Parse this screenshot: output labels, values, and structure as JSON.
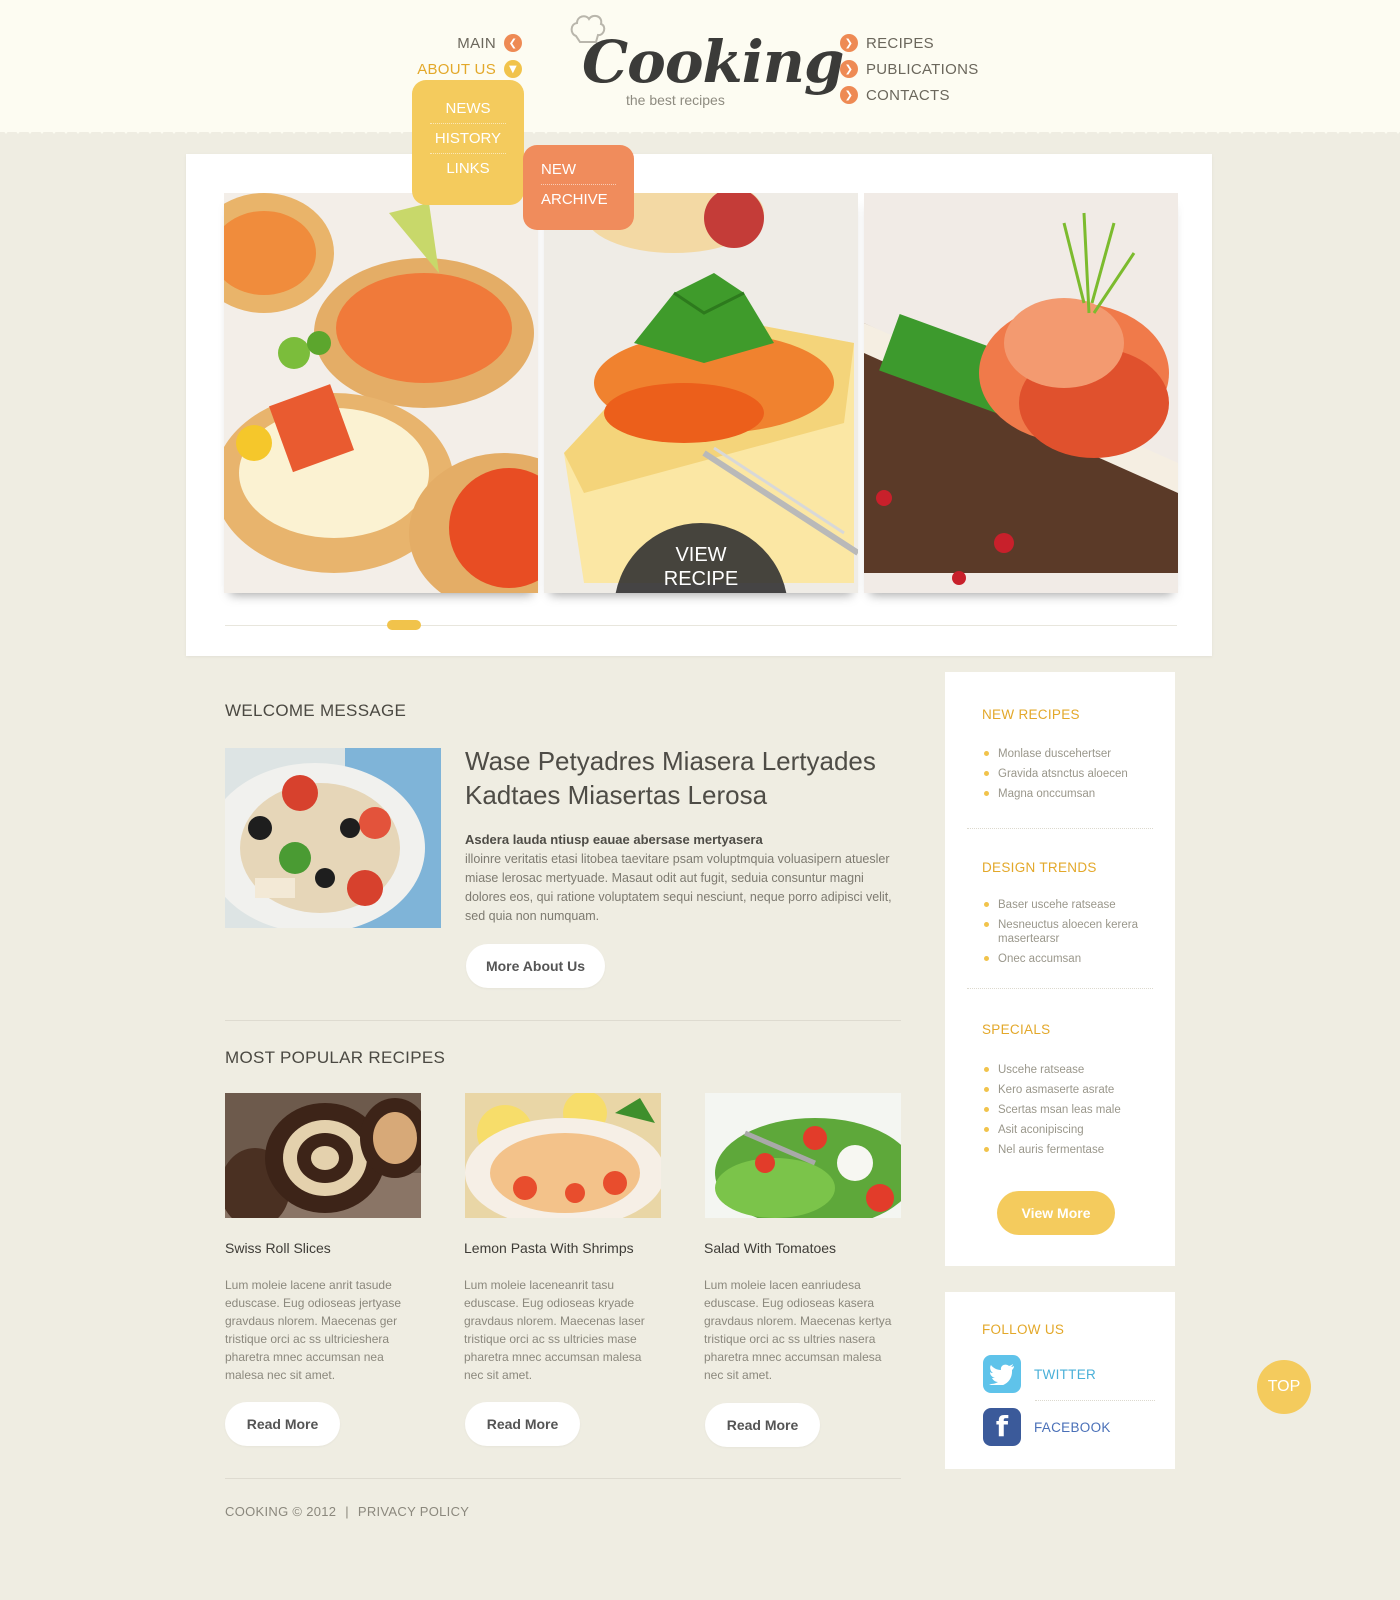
{
  "header": {
    "logo": {
      "title": "Cooking",
      "subtitle": "the best recipes"
    },
    "nav_left": [
      {
        "label": "MAIN",
        "icon": "chevron-left-icon"
      },
      {
        "label": "ABOUT US",
        "icon": "chevron-down-icon"
      }
    ],
    "nav_right": [
      {
        "label": "RECIPES",
        "icon": "chevron-right-icon"
      },
      {
        "label": "PUBLICATIONS",
        "icon": "chevron-right-icon"
      },
      {
        "label": "CONTACTS",
        "icon": "chevron-right-icon"
      }
    ],
    "about_dropdown": [
      "NEWS",
      "HISTORY",
      "LINKS"
    ],
    "sub_dropdown": [
      "NEW",
      "ARCHIVE"
    ]
  },
  "slider": {
    "view_recipe_line1": "VIEW",
    "view_recipe_line2": "RECIPE"
  },
  "welcome": {
    "section_title": "WELCOME MESSAGE",
    "heading_line1": "Wase Petyadres Miasera Lertyades",
    "heading_line2": "Kadtaes Miasertas Lerosa",
    "lead": "Asdera lauda ntiusp eauae abersase mertyasera",
    "body": "illoinre veritatis etasi litobea taevitare psam voluptmquia voluasipern atuesler miase lerosac mertyuade. Masaut odit aut fugit, seduia consuntur magni dolores eos, qui ratione voluptatem sequi nesciunt, neque porro adipisci velit, sed quia non numquam.",
    "button": "More About Us"
  },
  "popular": {
    "section_title": "MOST POPULAR RECIPES",
    "items": [
      {
        "title": "Swiss Roll Slices",
        "text": "Lum moleie lacene anrit tasude eduscase. Eug odioseas jertyase gravdaus nlorem. Maecenas ger tristique orci ac ss ultricieshera pharetra mnec accumsan nea malesa nec sit amet.",
        "button": "Read More"
      },
      {
        "title": "Lemon Pasta With Shrimps",
        "text": "Lum moleie laceneanrit tasu eduscase. Eug odioseas kryade gravdaus nlorem. Maecenas laser tristique orci ac ss ultricies mase pharetra mnec accumsan malesa nec sit amet.",
        "button": "Read More"
      },
      {
        "title": "Salad With Tomatoes",
        "text": "Lum moleie lacen eanriudesa eduscase. Eug odioseas kasera gravdaus nlorem. Maecenas kertya tristique orci ac ss ultries nasera pharetra mnec accumsan malesa nec sit amet.",
        "button": "Read More"
      }
    ]
  },
  "footer": {
    "copyright": "COOKING © 2012",
    "separator": "|",
    "privacy": "PRIVACY POLICY"
  },
  "sidebar": {
    "new_recipes": {
      "title": "NEW RECIPES",
      "items": [
        "Monlase duscehertser",
        "Gravida atsnctus aloecen",
        "Magna onccumsan"
      ]
    },
    "design_trends": {
      "title": "DESIGN TRENDS",
      "items": [
        "Baser uscehe ratsease",
        "Nesneuctus aloecen kerera masertearsr",
        "Onec accumsan"
      ]
    },
    "specials": {
      "title": "SPECIALS",
      "items": [
        "Uscehe ratsease",
        "Kero asmaserte asrate",
        "Scertas msan leas male",
        "Asit aconipiscing",
        "Nel auris fermentase"
      ]
    },
    "view_more": "View More",
    "follow": {
      "title": "FOLLOW US",
      "twitter": "TWITTER",
      "facebook": "FACEBOOK"
    }
  },
  "top_button": "TOP",
  "colors": {
    "accent_yellow": "#f4cb5d",
    "accent_orange": "#f08c5c",
    "background": "#efede2"
  }
}
